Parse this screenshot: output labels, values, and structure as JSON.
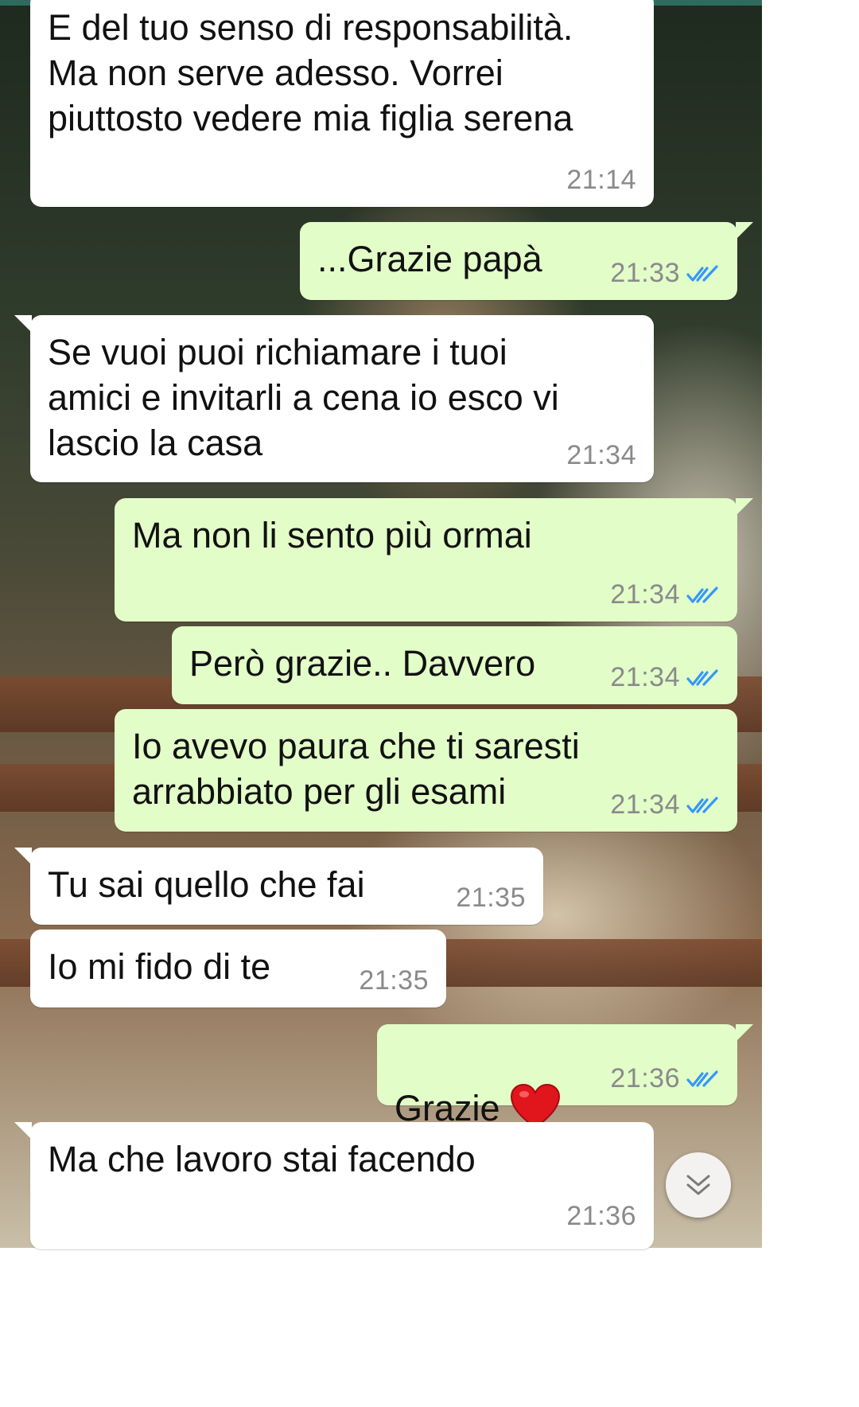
{
  "chat": {
    "messages": [
      {
        "direction": "in",
        "text": "E del tuo senso di responsabilità.\nMa non serve adesso. Vorrei\npiuttosto vedere mia figlia serena",
        "time": "21:14"
      },
      {
        "direction": "out",
        "text": "...Grazie papà",
        "time": "21:33",
        "status": "read"
      },
      {
        "direction": "in",
        "text": "Se vuoi puoi richiamare i tuoi\namici e invitarli a  cena io esco vi\nlascio la casa",
        "time": "21:34"
      },
      {
        "direction": "out",
        "text": "Ma non li sento più ormai",
        "time": "21:34",
        "status": "read"
      },
      {
        "direction": "out",
        "text": "Però grazie.. Davvero",
        "time": "21:34",
        "status": "read"
      },
      {
        "direction": "out",
        "text": "Io avevo paura che ti saresti\narrabbiato per gli esami",
        "time": "21:34",
        "status": "read"
      },
      {
        "direction": "in",
        "text": "Tu sai quello che fai",
        "time": "21:35"
      },
      {
        "direction": "in",
        "text": "Io mi fido di te",
        "time": "21:35"
      },
      {
        "direction": "out",
        "text": "Grazie",
        "emoji": "red-heart",
        "time": "21:36",
        "status": "read"
      },
      {
        "direction": "in",
        "text": "Ma che lavoro stai facendo",
        "time": "21:36"
      }
    ]
  },
  "colors": {
    "incoming_bubble": "#ffffff",
    "outgoing_bubble": "#e2fdc8",
    "read_ticks": "#3497f9",
    "timestamp": "#8a8a8a",
    "top_bar": "#2e6b5e"
  },
  "icons": {
    "read_receipt": "double-check-icon",
    "scroll_down": "chevron-double-down-icon"
  }
}
